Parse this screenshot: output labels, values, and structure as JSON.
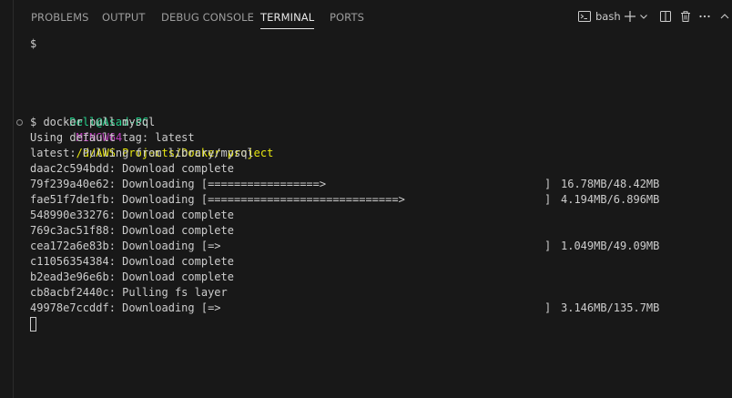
{
  "tabs": [
    {
      "label": "PROBLEMS"
    },
    {
      "label": "OUTPUT"
    },
    {
      "label": "DEBUG CONSOLE"
    },
    {
      "label": "TERMINAL"
    },
    {
      "label": "PORTS"
    }
  ],
  "toolbar": {
    "shell_label": "bash",
    "add_icon": "plus-icon",
    "dropdown_icon": "chevron-down-icon",
    "split_icon": "split-icon",
    "trash_icon": "trash-icon",
    "more_icon": "ellipsis-icon",
    "maximize_icon": "chevron-up-icon",
    "close_icon": "close-icon"
  },
  "terminal": {
    "first_prompt": "$",
    "user_host": "Dell@Asad-PC",
    "env": "MINGW64",
    "path": "/d/AWS Projects/Docker project",
    "command": "$ docker pull mysql",
    "lines": [
      "Using default tag: latest",
      "latest: Pulling from library/mysql",
      "daac2c594bdd: Download complete"
    ],
    "layers": [
      {
        "text": "79f239a40e62: Downloading [=================>",
        "close": "]",
        "size": "16.78MB/48.42MB"
      },
      {
        "text": "fae51f7de1fb: Downloading [=============================>",
        "close": "]",
        "size": "4.194MB/6.896MB"
      }
    ],
    "lines2": [
      "548990e33276: Download complete",
      "769c3ac51f88: Download complete"
    ],
    "layer3": {
      "text": "cea172a6e83b: Downloading [=>",
      "close": "]",
      "size": "1.049MB/49.09MB"
    },
    "lines3": [
      "c11056354384: Download complete",
      "b2ead3e96e6b: Download complete",
      "cb8acbf2440c: Pulling fs layer"
    ],
    "layer4": {
      "text": "49978e7ccddf: Downloading [=>",
      "close": "]",
      "size": "3.146MB/135.7MB"
    }
  },
  "colors": {
    "background": "#181818",
    "user_host": "#23d18b",
    "env": "#bc3fbc",
    "path": "#e5e510"
  }
}
